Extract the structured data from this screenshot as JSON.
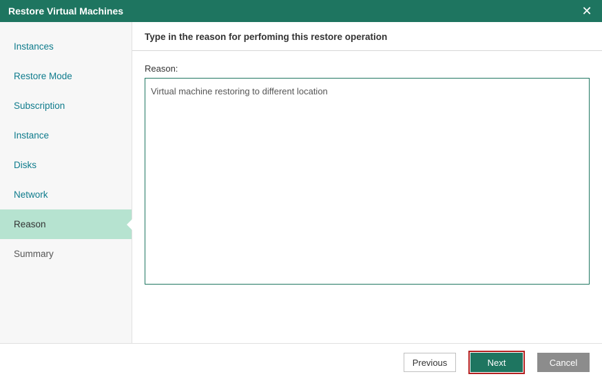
{
  "titlebar": {
    "title": "Restore Virtual Machines"
  },
  "sidebar": {
    "items": [
      {
        "label": "Instances"
      },
      {
        "label": "Restore Mode"
      },
      {
        "label": "Subscription"
      },
      {
        "label": "Instance"
      },
      {
        "label": "Disks"
      },
      {
        "label": "Network"
      },
      {
        "label": "Reason"
      },
      {
        "label": "Summary"
      }
    ]
  },
  "main": {
    "header": "Type in the reason for perfoming this restore operation",
    "reason_label": "Reason:",
    "reason_value": "Virtual machine restoring to different location"
  },
  "footer": {
    "previous": "Previous",
    "next": "Next",
    "cancel": "Cancel"
  }
}
